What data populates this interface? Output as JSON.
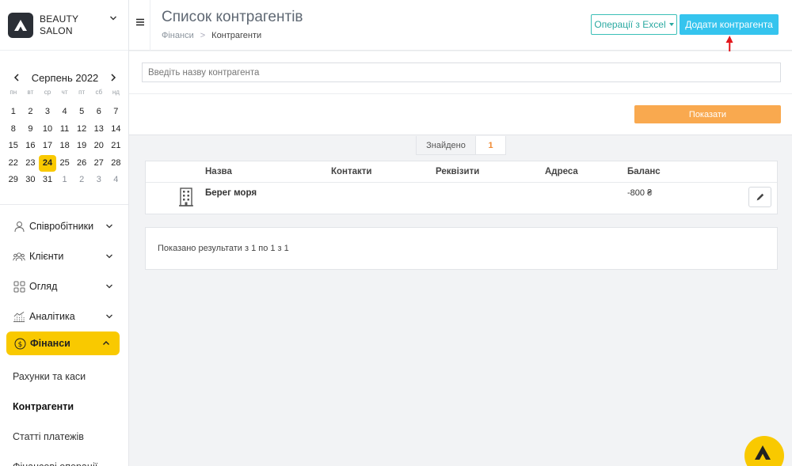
{
  "brand": {
    "name": "BEAUTY SALON"
  },
  "calendar": {
    "title": "Серпень 2022",
    "weekdays": [
      "пн",
      "вт",
      "ср",
      "чт",
      "пт",
      "сб",
      "нд"
    ],
    "days": [
      {
        "d": "1",
        "o": false
      },
      {
        "d": "2",
        "o": false
      },
      {
        "d": "3",
        "o": false
      },
      {
        "d": "4",
        "o": false
      },
      {
        "d": "5",
        "o": false
      },
      {
        "d": "6",
        "o": false
      },
      {
        "d": "7",
        "o": false
      },
      {
        "d": "8",
        "o": false
      },
      {
        "d": "9",
        "o": false
      },
      {
        "d": "10",
        "o": false
      },
      {
        "d": "11",
        "o": false
      },
      {
        "d": "12",
        "o": false
      },
      {
        "d": "13",
        "o": false
      },
      {
        "d": "14",
        "o": false
      },
      {
        "d": "15",
        "o": false
      },
      {
        "d": "16",
        "o": false
      },
      {
        "d": "17",
        "o": false
      },
      {
        "d": "18",
        "o": false
      },
      {
        "d": "19",
        "o": false
      },
      {
        "d": "20",
        "o": false
      },
      {
        "d": "21",
        "o": false
      },
      {
        "d": "22",
        "o": false
      },
      {
        "d": "23",
        "o": false
      },
      {
        "d": "24",
        "o": false,
        "today": true
      },
      {
        "d": "25",
        "o": false
      },
      {
        "d": "26",
        "o": false
      },
      {
        "d": "27",
        "o": false
      },
      {
        "d": "28",
        "o": false
      },
      {
        "d": "29",
        "o": false
      },
      {
        "d": "30",
        "o": false
      },
      {
        "d": "31",
        "o": false
      },
      {
        "d": "1",
        "o": true
      },
      {
        "d": "2",
        "o": true
      },
      {
        "d": "3",
        "o": true
      },
      {
        "d": "4",
        "o": true
      }
    ]
  },
  "nav": {
    "items": [
      {
        "label": "Співробітники"
      },
      {
        "label": "Клієнти"
      },
      {
        "label": "Огляд"
      },
      {
        "label": "Аналітика"
      },
      {
        "label": "Фінанси"
      }
    ],
    "sub_items": [
      {
        "label": "Рахунки та каси"
      },
      {
        "label": "Контрагенти"
      },
      {
        "label": "Статті платежів"
      },
      {
        "label": "Фінансові операції"
      }
    ]
  },
  "header": {
    "title": "Список контрагентів",
    "breadcrumb": [
      "Фінанси",
      ">",
      "Контрагенти"
    ],
    "excel_label": "Операції з Excel",
    "add_label": "Додати контрагента"
  },
  "filter": {
    "search_placeholder": "Введіть назву контрагента",
    "show_label": "Показати"
  },
  "found": {
    "label": "Знайдено",
    "count": "1"
  },
  "table": {
    "headers": [
      "Назва",
      "Контакти",
      "Реквізити",
      "Адреса",
      "Баланс"
    ],
    "rows": [
      {
        "name": "Берег моря",
        "contacts": "",
        "requisites": "",
        "address": "",
        "balance": "-800 ₴"
      }
    ]
  },
  "results": {
    "text": "Показано результати з 1 по 1 з 1"
  },
  "colors": {
    "accent_yellow": "#f9c900",
    "primary_blue": "#35c4ee",
    "teal": "#3bbfb7",
    "orange": "#f9a94f",
    "arrow_red": "#e3161b"
  }
}
